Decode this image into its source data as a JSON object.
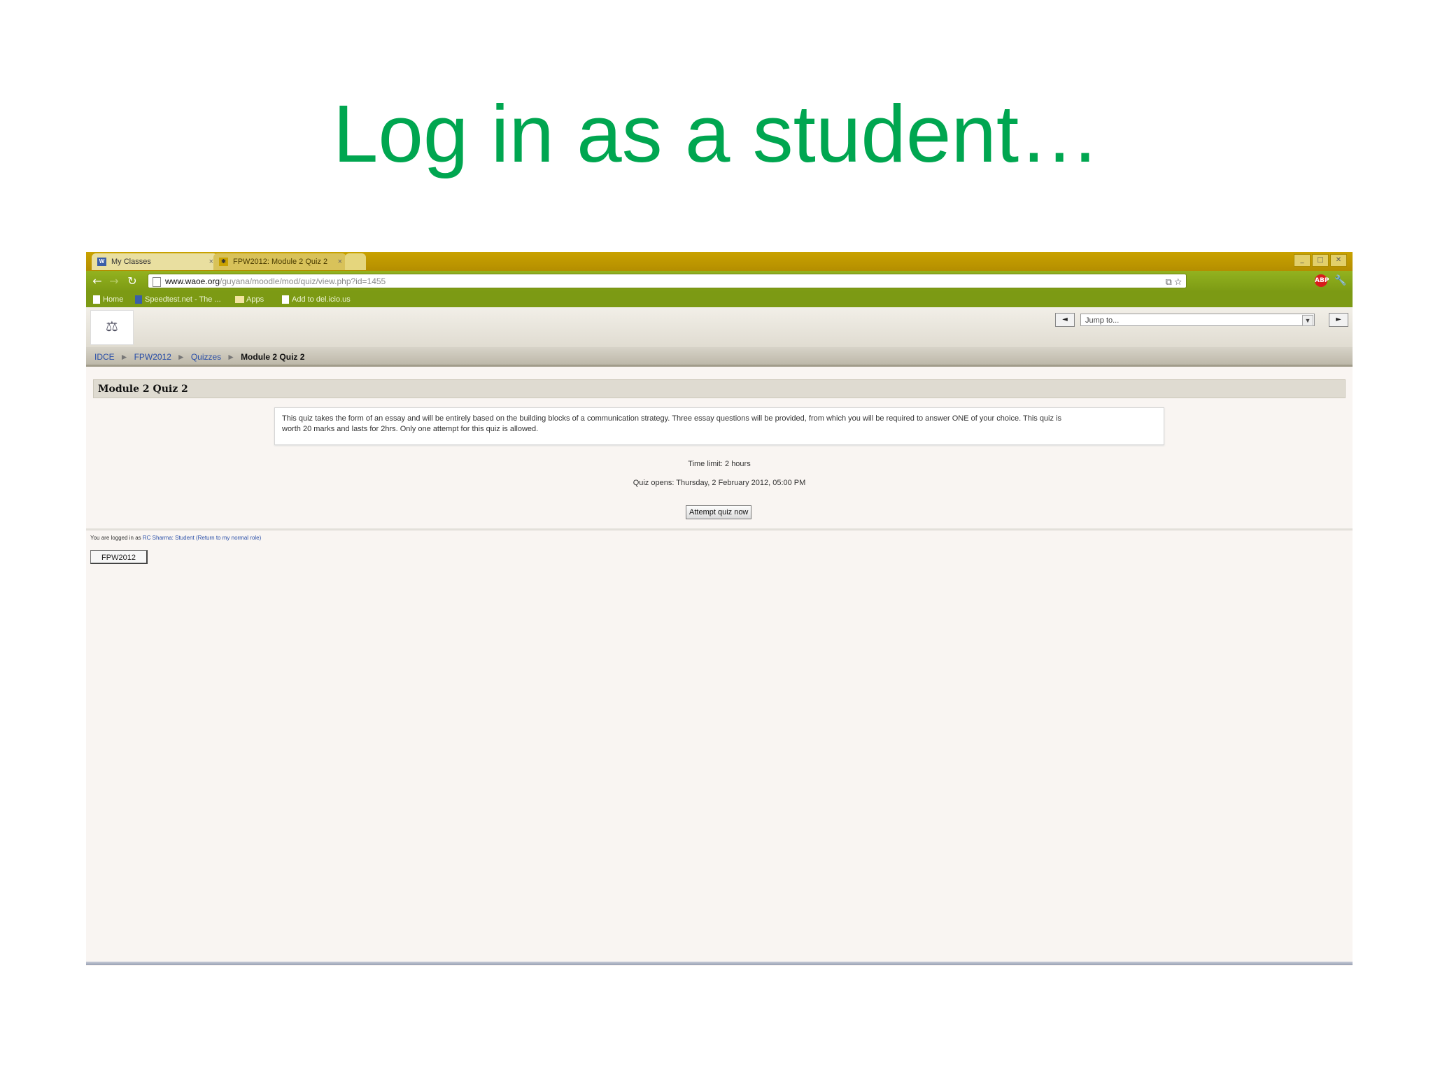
{
  "slide": {
    "title": "Log in as a student…"
  },
  "browser": {
    "tabs": [
      {
        "label": "My Classes",
        "icon": "w-logo-icon",
        "close": "×"
      },
      {
        "label": "FPW2012: Module 2 Quiz 2",
        "icon": "pin-icon",
        "close": "×"
      }
    ],
    "url": {
      "host": "www.waoe.org",
      "path": "/guyana/moodle/mod/quiz/view.php?id=1455"
    },
    "bookmarks": [
      {
        "label": "Home"
      },
      {
        "label": "Speedtest.net - The ..."
      },
      {
        "label": "Apps"
      },
      {
        "label": "Add to del.icio.us"
      }
    ]
  },
  "moodle": {
    "jump": {
      "prev": "◄",
      "placeholder": "Jump to...",
      "next": "►"
    },
    "breadcrumb": {
      "items": [
        "IDCE",
        "FPW2012",
        "Quizzes"
      ],
      "current": "Module 2 Quiz 2",
      "separator": "►"
    },
    "heading": "Module 2 Quiz 2",
    "intro_line1": "This quiz takes the form of an essay and will be entirely based on the building blocks of a communication strategy. Three essay questions will be provided, from which you will be required to answer ONE of your choice. This quiz is",
    "intro_line2": "worth 20 marks and lasts for 2hrs. Only one attempt for this quiz is allowed.",
    "time_limit": "Time limit: 2 hours",
    "quiz_opens": "Quiz opens: Thursday, 2 February 2012, 05:00 PM",
    "attempt_button": "Attempt quiz now",
    "login_prefix": "You are logged in as",
    "login_user": "RC Sharma: Student",
    "login_link": "(Return to my normal role)",
    "course_button": "FPW2012"
  }
}
